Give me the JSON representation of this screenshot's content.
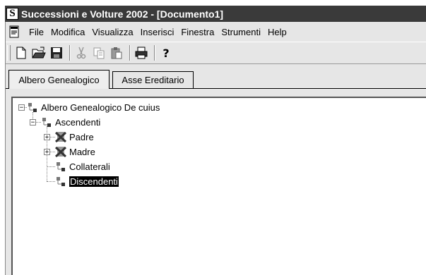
{
  "window": {
    "title": "Successioni e Volture 2002 - [Documento1]",
    "logo": "S"
  },
  "menu": [
    "File",
    "Modifica",
    "Visualizza",
    "Inserisci",
    "Finestra",
    "Strumenti",
    "Help"
  ],
  "toolbar": {
    "buttons": [
      "new-file-icon",
      "open-folder-icon",
      "save-icon",
      "cut-icon",
      "copy-icon",
      "paste-icon",
      "print-icon",
      "help-icon"
    ]
  },
  "tabs": [
    {
      "label": "Albero Genealogico",
      "active": true
    },
    {
      "label": "Asse Ereditario",
      "active": false
    }
  ],
  "tree": {
    "root": "Albero Genealogico De cuius",
    "ascendenti": "Ascendenti",
    "padre": "Padre",
    "madre": "Madre",
    "collaterali": "Collaterali",
    "discendenti": "Discendenti",
    "selected": "Discendenti"
  }
}
